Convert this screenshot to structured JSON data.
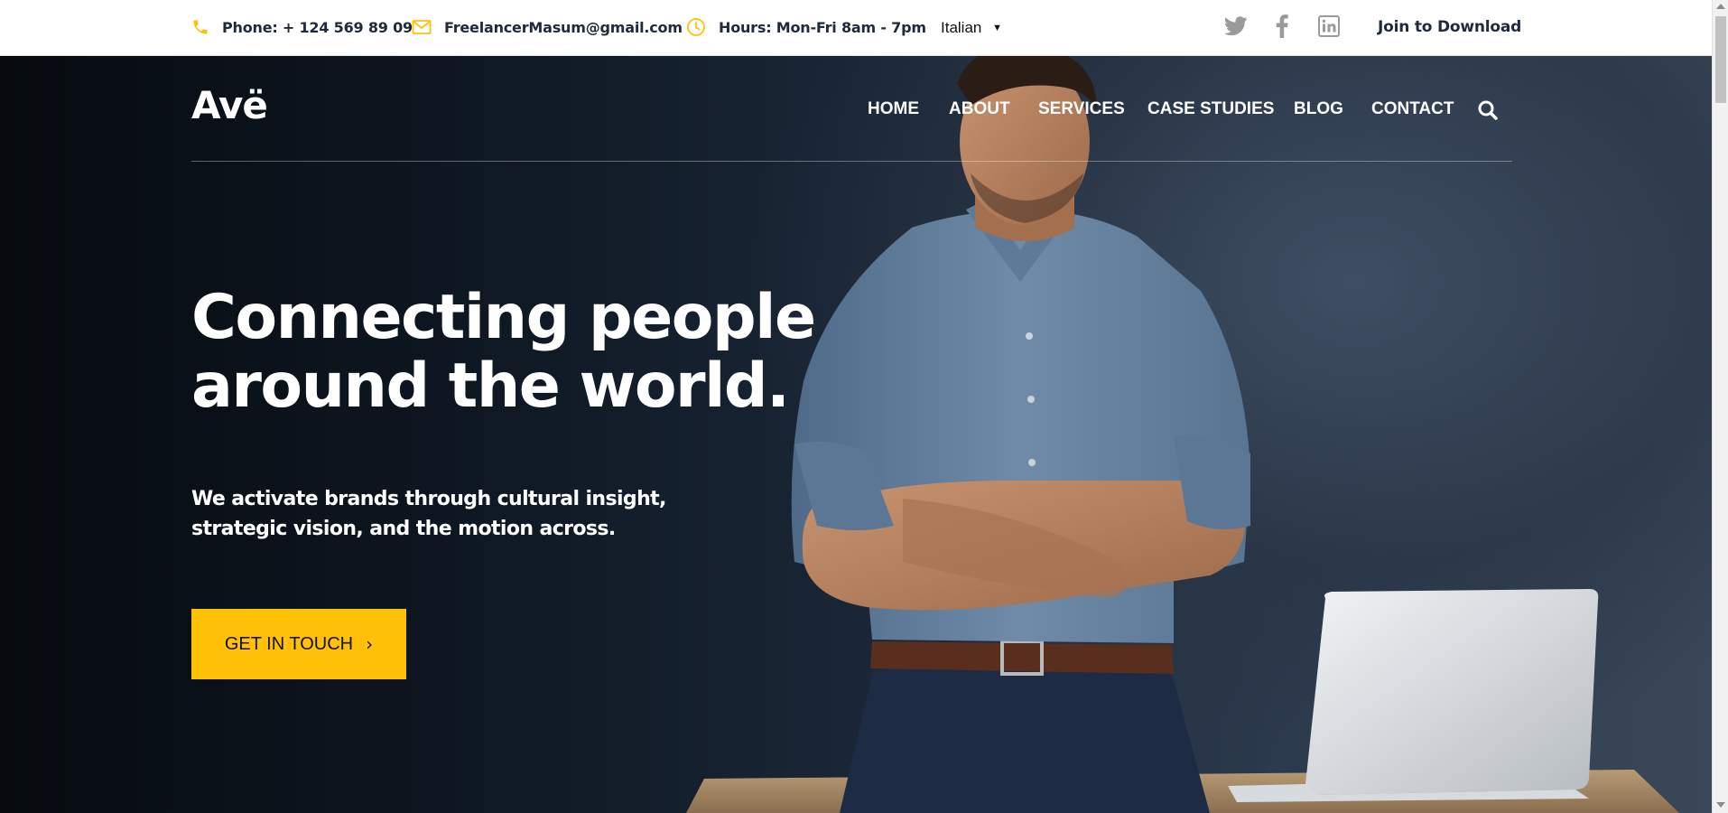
{
  "topbar": {
    "phone": "Phone: + 124 569 89 09",
    "email": "FreelancerMasum@gmail.com",
    "hours": "Hours: Mon-Fri 8am - 7pm",
    "language": "Italian",
    "join": "Join to Download",
    "icons": [
      "phone-icon",
      "mail-icon",
      "clock-icon",
      "twitter-icon",
      "facebook-icon",
      "linkedin-icon"
    ],
    "colors": {
      "icon_accent": "#ffc107",
      "text": "#1f2a3a",
      "social": "#9a9a9a"
    }
  },
  "header": {
    "logo": "Avë",
    "nav": [
      "HOME",
      "ABOUT",
      "SERVICES",
      "CASE STUDIES",
      "BLOG",
      "CONTACT"
    ]
  },
  "hero": {
    "title_line1": "Connecting people",
    "title_line2": "around the world.",
    "subtitle_line1": "We activate brands through cultural insight,",
    "subtitle_line2": "strategic vision, and the motion across.",
    "cta_label": "GET IN TOUCH",
    "cta_color": "#ffc107"
  }
}
